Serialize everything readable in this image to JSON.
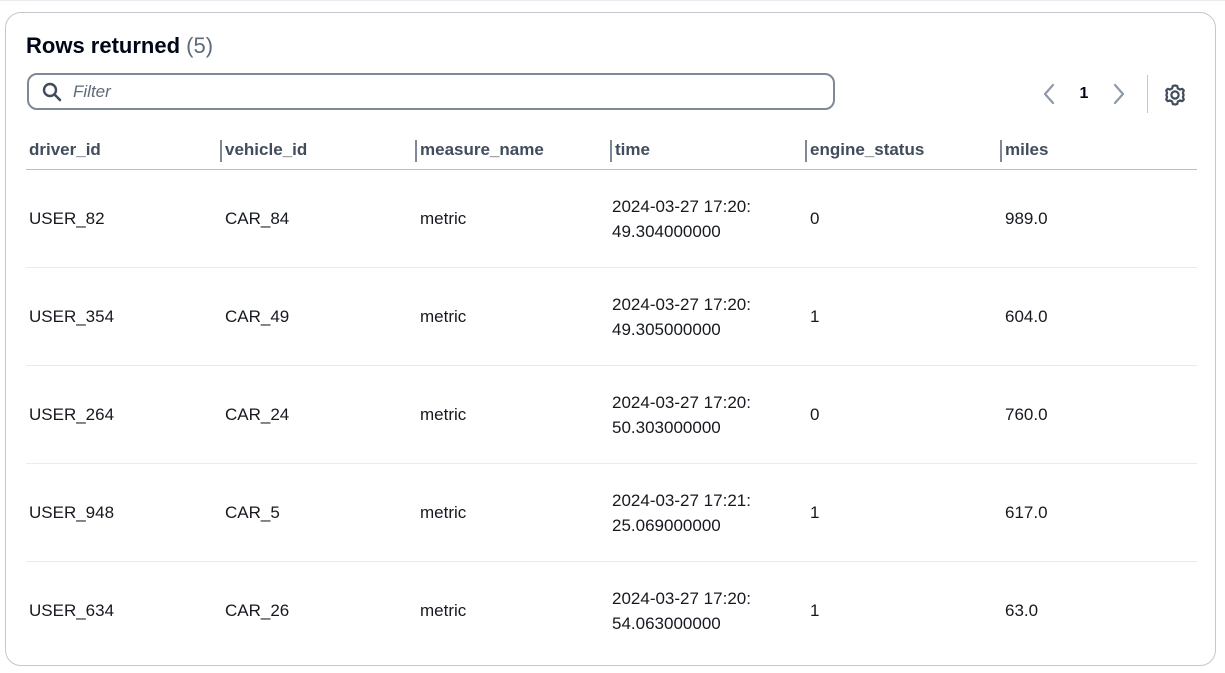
{
  "panel": {
    "title": "Rows returned",
    "count": "(5)"
  },
  "filter": {
    "placeholder": "Filter",
    "value": ""
  },
  "pagination": {
    "current_page": "1"
  },
  "table": {
    "columns": [
      "driver_id",
      "vehicle_id",
      "measure_name",
      "time",
      "engine_status",
      "miles"
    ],
    "rows": [
      [
        "USER_82",
        "CAR_84",
        "metric",
        "2024-03-27 17:20:49.304000000",
        "0",
        "989.0"
      ],
      [
        "USER_354",
        "CAR_49",
        "metric",
        "2024-03-27 17:20:49.305000000",
        "1",
        "604.0"
      ],
      [
        "USER_264",
        "CAR_24",
        "metric",
        "2024-03-27 17:20:50.303000000",
        "0",
        "760.0"
      ],
      [
        "USER_948",
        "CAR_5",
        "metric",
        "2024-03-27 17:21:25.069000000",
        "1",
        "617.0"
      ],
      [
        "USER_634",
        "CAR_26",
        "metric",
        "2024-03-27 17:20:54.063000000",
        "1",
        "63.0"
      ]
    ]
  },
  "icons": {
    "search": "search-icon",
    "prev": "chevron-left-icon",
    "next": "chevron-right-icon",
    "settings": "gear-icon"
  },
  "colors": {
    "border": "#c6c6cd",
    "text": "#16191f",
    "header_text": "#414d5c",
    "muted": "#5f6b7a"
  }
}
